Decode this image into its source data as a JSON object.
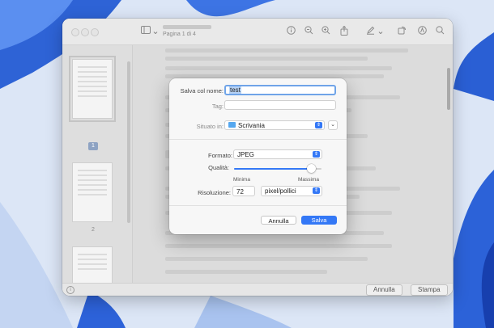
{
  "colors": {
    "accent": "#3478f6",
    "wallpaper_blue": "#2f66d8",
    "dialog_bg": "#f7f7f7"
  },
  "window": {
    "subtitle": "Pagina 1 di 4",
    "toolbar_icons": [
      "sidebar-icon",
      "chevron-down-icon",
      "info-icon",
      "zoom-out-icon",
      "zoom-in-icon",
      "share-icon",
      "markup-pen-icon",
      "chevron-down-icon",
      "rotate-icon",
      "annotate-icon",
      "search-icon"
    ],
    "sidebar": {
      "pages": [
        {
          "label": "1",
          "selected": true
        },
        {
          "label": "2",
          "selected": false
        }
      ]
    },
    "bottom_bar": {
      "cancel_label": "Annulla",
      "print_label": "Stampa"
    }
  },
  "dialog": {
    "save_as_label": "Salva col nome:",
    "filename": "test",
    "tags_label": "Tag:",
    "tags_value": "",
    "location_label": "Situato in:",
    "location_value": "Scrivania",
    "format_label": "Formato:",
    "format_value": "JPEG",
    "quality_label": "Qualità:",
    "quality_level": 0.88,
    "quality_min_label": "Minima",
    "quality_max_label": "Massima",
    "resolution_label": "Risoluzione:",
    "resolution_value": "72",
    "resolution_unit": "pixel/pollici",
    "cancel_label": "Annulla",
    "save_label": "Salva"
  }
}
